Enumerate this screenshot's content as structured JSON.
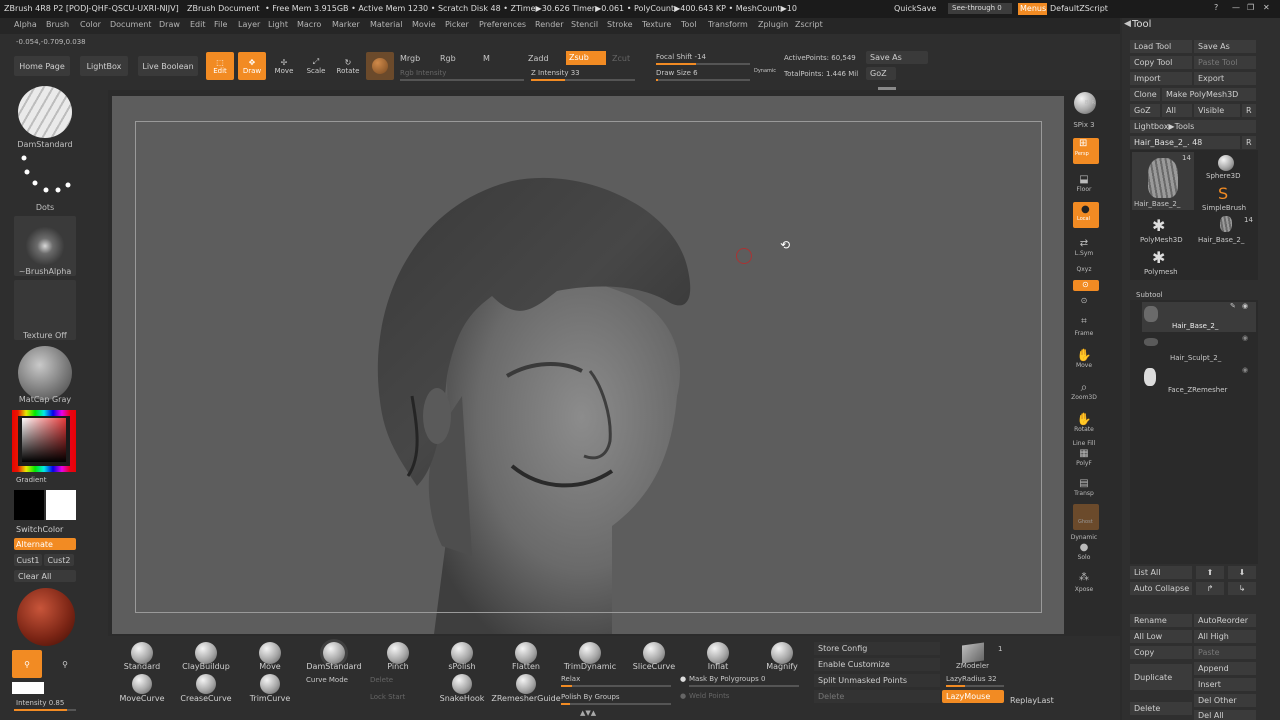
{
  "titlebar": {
    "title": "ZBrush 4R8 P2 [PODJ-QHF-QSCU-UXRI-NIJV]",
    "document": "ZBrush Document",
    "stats": "• Free Mem 3.915GB • Active Mem 1230 • Scratch Disk 48 • ZTime▶30.626 Timer▶0.061 • PolyCount▶400.643 KP • MeshCount▶10",
    "quicksave": "QuickSave",
    "seethrough": "See-through 0",
    "menus": "Menus",
    "script": "DefaultZScript"
  },
  "menubar": [
    "Alpha",
    "Brush",
    "Color",
    "Document",
    "Draw",
    "Edit",
    "File",
    "Layer",
    "Light",
    "Macro",
    "Marker",
    "Material",
    "Movie",
    "Picker",
    "Preferences",
    "Render",
    "Stencil",
    "Stroke",
    "Texture",
    "Tool",
    "Transform",
    "Zplugin",
    "Zscript"
  ],
  "coords": "-0.054,-0.709,0.038",
  "shelf": {
    "home": "Home Page",
    "lightbox": "LightBox",
    "liveboolean": "Live Boolean",
    "edit": "Edit",
    "draw": "Draw",
    "move": "Move",
    "scale": "Scale",
    "rotate": "Rotate",
    "mrgb": "Mrgb",
    "rgb": "Rgb",
    "m": "M",
    "rgb_intensity": "Rgb Intensity",
    "zadd": "Zadd",
    "zsub": "Zsub",
    "zcut": "Zcut",
    "z_intensity": "Z Intensity 33",
    "focal_shift": "Focal Shift -14",
    "draw_size": "Draw Size 6",
    "dynamic": "Dynamic",
    "active_points": "ActivePoints: 60,549",
    "total_points": "TotalPoints: 1.446 Mil",
    "save_as": "Save As",
    "goz": "GoZ"
  },
  "left": {
    "brush": "DamStandard",
    "stroke": "Dots",
    "alpha": "~BrushAlpha",
    "texture": "Texture Off",
    "material": "MatCap Gray",
    "gradient": "Gradient",
    "switchcolor": "SwitchColor",
    "alternate": "Alternate",
    "cust1": "Cust1",
    "cust2": "Cust2",
    "clearall": "Clear All",
    "intensity": "Intensity 0.85"
  },
  "right_shelf": {
    "bpr": "BPR",
    "spix": "SPix 3",
    "persp": "Persp",
    "floor": "Floor",
    "local": "Local",
    "lsym": "L.Sym",
    "xyz": "Qxyz",
    "frame": "Frame",
    "move": "Move",
    "zoom3d": "Zoom3D",
    "rotate": "Rotate",
    "linefill": "Line Fill",
    "polyf": "PolyF",
    "transp": "Transp",
    "ghost": "Ghost",
    "dynamic": "Dynamic",
    "solo": "Solo",
    "xpose": "Xpose"
  },
  "tool": {
    "header": "Tool",
    "load": "Load Tool",
    "saveas": "Save As",
    "copy": "Copy Tool",
    "paste": "Paste Tool",
    "import": "Import",
    "export": "Export",
    "clone": "Clone",
    "makepoly": "Make PolyMesh3D",
    "goz": "GoZ",
    "all": "All",
    "visible": "Visible",
    "r": "R",
    "lightbox_tools": "Lightbox▶Tools",
    "current_tool": "Hair_Base_2_. 48",
    "thumb_count": "14",
    "thumbs": [
      "Hair_Base_2_",
      "Sphere3D",
      "SimpleBrush",
      "PolyMesh3D",
      "Hair_Base_2_",
      "Polymesh"
    ],
    "thumb_count2": "14",
    "subtool_header": "Subtool",
    "subtools": [
      "Hair_Base_2_",
      "Hair_Sculpt_2_",
      "Face_ZRemesher"
    ],
    "listall": "List All",
    "autocollapse": "Auto Collapse",
    "rename": "Rename",
    "autoreorder": "AutoReorder",
    "alllow": "All Low",
    "allhigh": "All High",
    "copy2": "Copy",
    "paste2": "Paste",
    "duplicate": "Duplicate",
    "append": "Append",
    "insert": "Insert",
    "delother": "Del Other",
    "delete": "Delete",
    "delall": "Del All"
  },
  "bottom": {
    "brushes_row1": [
      "Standard",
      "ClayBuildup",
      "Move",
      "DamStandard",
      "Pinch",
      "sPolish",
      "Flatten",
      "TrimDynamic",
      "SliceCurve",
      "Inflat",
      "Magnify"
    ],
    "brushes_row2": [
      "MoveCurve",
      "CreaseCurve",
      "TrimCurve",
      "",
      "",
      "SnakeHook",
      "ZRemesherGuide"
    ],
    "curve_mode": "Curve Mode",
    "delete": "Delete",
    "lock_start": "Lock Start",
    "relax": "Relax",
    "polish_groups": "Polish By Groups",
    "mask_polygroups": "Mask By Polygroups 0",
    "weld_points": "Weld Points",
    "store_config": "Store Config",
    "enable_customize": "Enable Customize",
    "split_unmasked": "Split Unmasked Points",
    "delete2": "Delete",
    "zmodeler": "ZModeler",
    "zmodeler_count": "1",
    "lazyradius": "LazyRadius 32",
    "lazymouse": "LazyMouse",
    "replaylast": "ReplayLast"
  },
  "colors": {
    "accent": "#f28b23",
    "bg": "#2b2b2b",
    "canvas": "#5d5d5d"
  },
  "progress": {
    "rgb_intensity": 0.0,
    "z_intensity": 0.33,
    "focal_shift": 0.43,
    "draw_size": 0.02,
    "lazyradius": 0.32,
    "intensity": 0.85
  }
}
